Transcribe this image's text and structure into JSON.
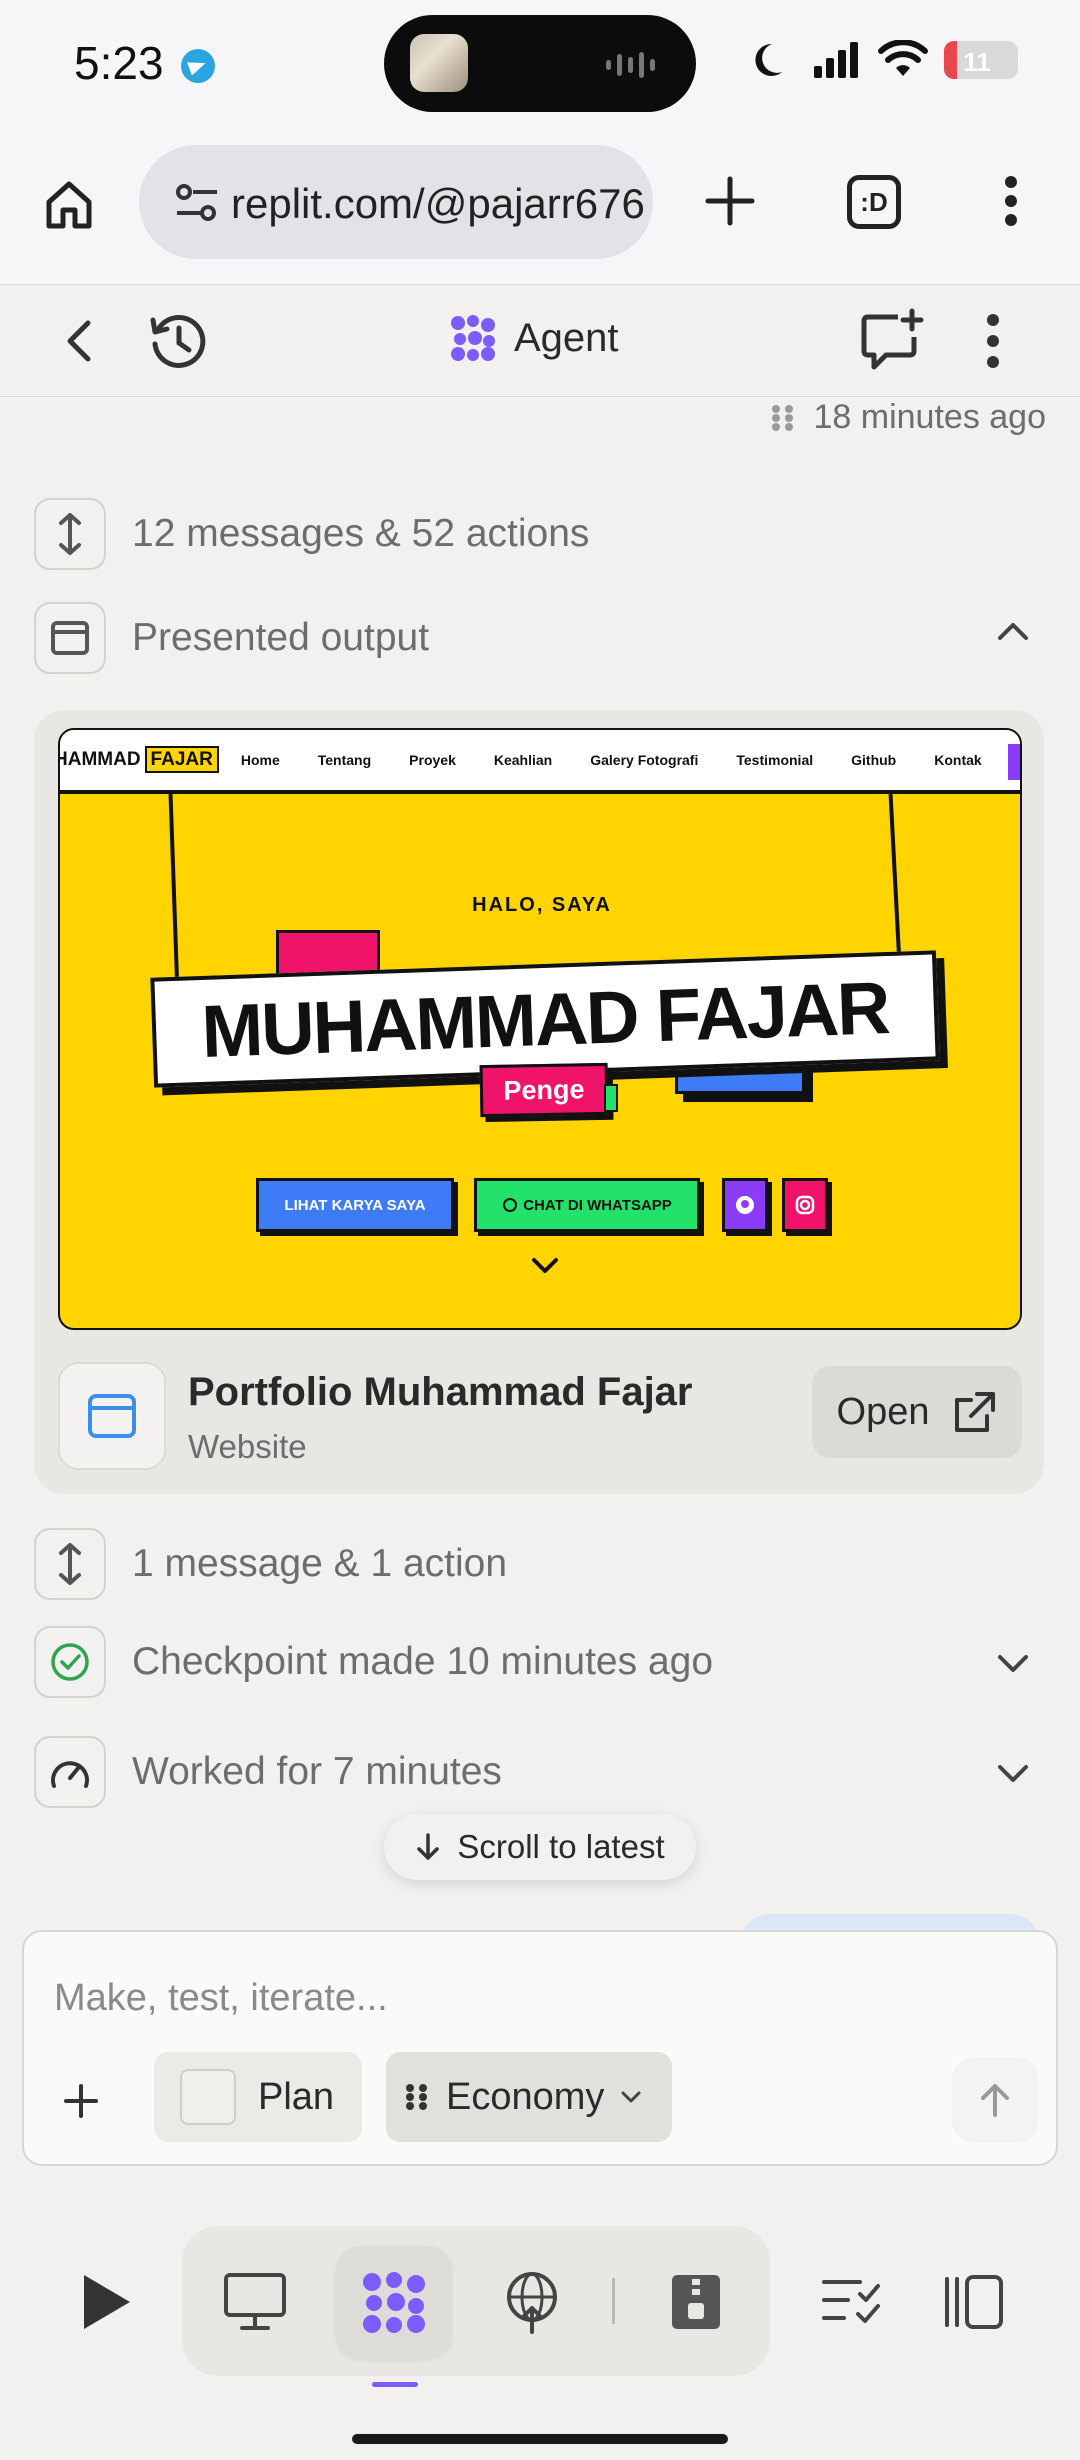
{
  "status_bar": {
    "time": "5:23",
    "battery": "11"
  },
  "browser": {
    "url": "replit.com/@pajarr676",
    "tab_label": ":D"
  },
  "header": {
    "title": "Agent"
  },
  "feed": {
    "timestamp": "18 minutes ago",
    "group1": "12 messages & 52 actions",
    "presented": "Presented output",
    "preview": {
      "logo_a": "HAMMAD",
      "logo_b": "FAJAR",
      "nav": [
        "Home",
        "Tentang",
        "Proyek",
        "Keahlian",
        "Galery Fotografi",
        "Testimonial",
        "Github",
        "Kontak"
      ],
      "halo": "HALO, SAYA",
      "name": "MUHAMMAD FAJAR",
      "tag": "Penge",
      "btn_primary": "LIHAT KARYA SAYA",
      "btn_whatsapp": "CHAT DI WHATSAPP"
    },
    "project": {
      "name": "Portfolio Muhammad Fajar",
      "type": "Website",
      "open_label": "Open"
    },
    "group2": "1 message & 1 action",
    "checkpoint": "Checkpoint made 10 minutes ago",
    "worked": "Worked for 7 minutes",
    "scroll_latest": "Scroll to latest"
  },
  "composer": {
    "placeholder": "Make, test, iterate...",
    "plan_label": "Plan",
    "mode_label": "Economy"
  },
  "colors": {
    "accent": "#7b5cff",
    "preview_yellow": "#ffd400",
    "preview_pink": "#f0136a",
    "preview_blue": "#3d7bf7",
    "preview_green": "#22e26a"
  }
}
